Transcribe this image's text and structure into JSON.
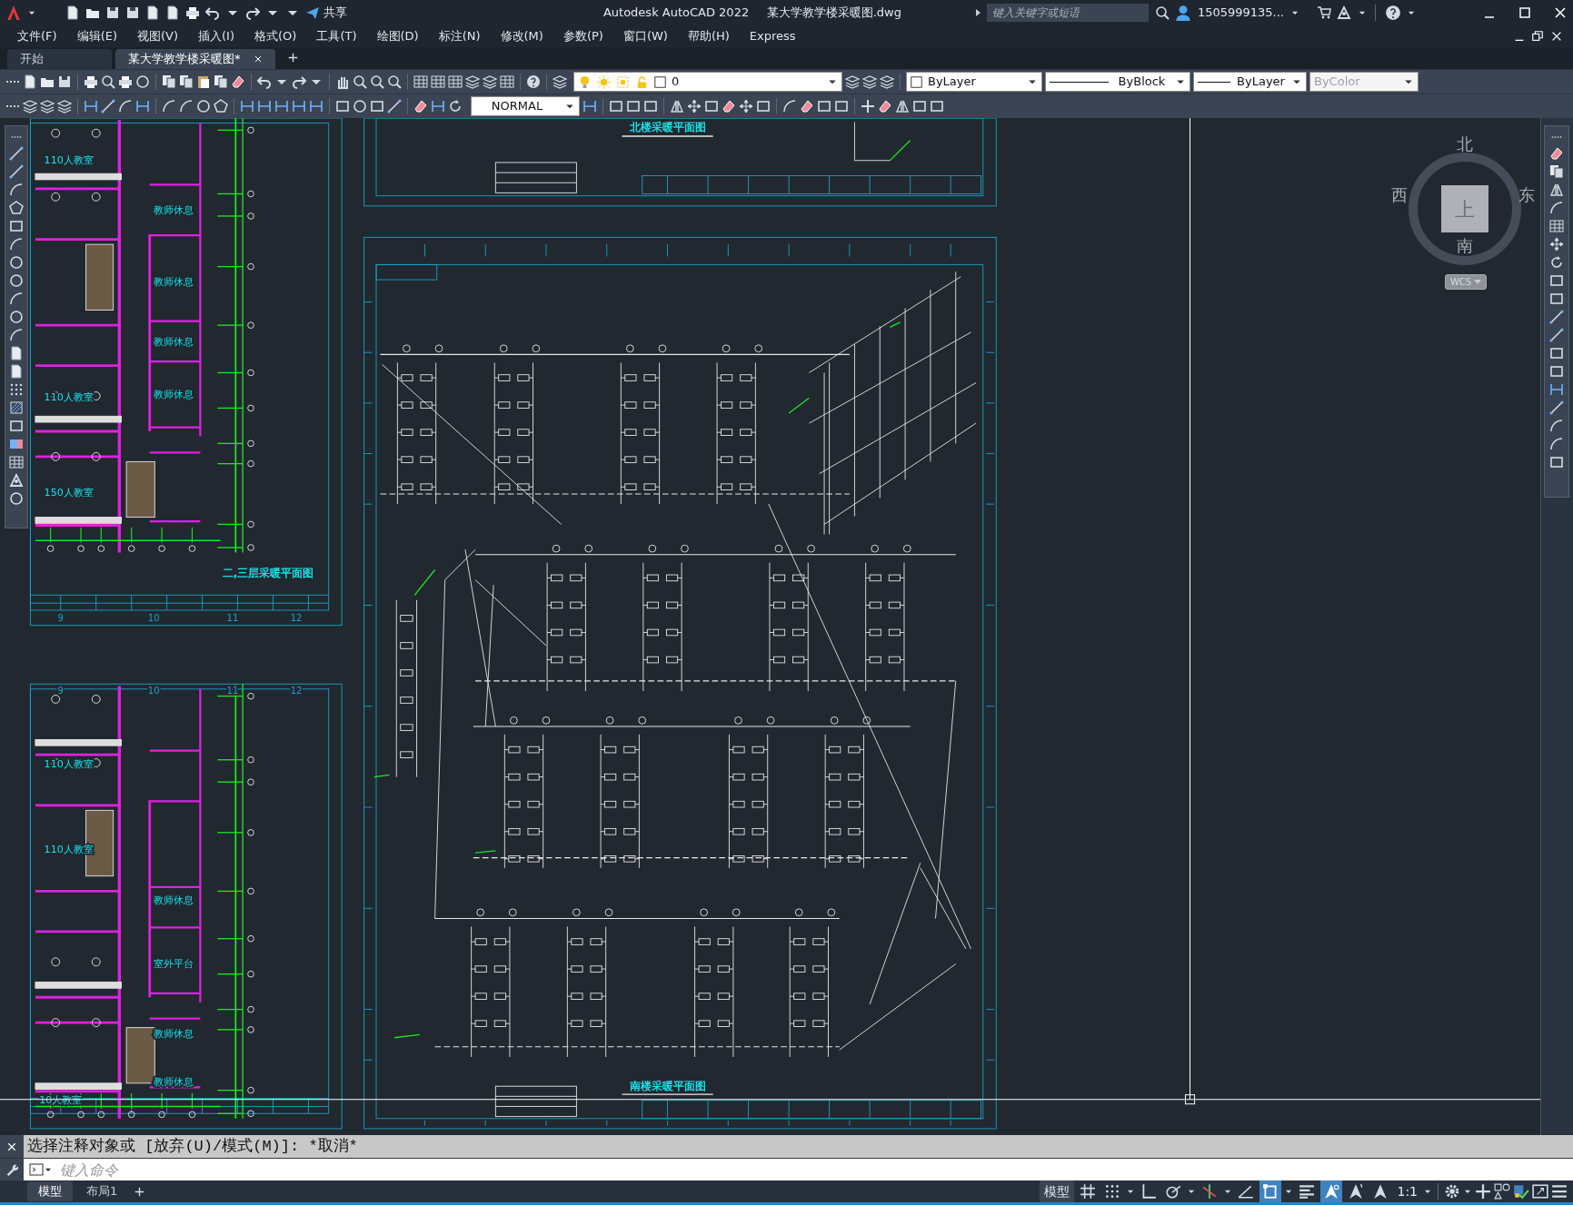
{
  "title_bar": {
    "share": "共享",
    "title": "Autodesk AutoCAD 2022",
    "file": "某大学教学楼采暖图.dwg",
    "search": {
      "placeholder": "键入关键字或短语"
    },
    "user": "1505999135..."
  },
  "menu": [
    "文件(F)",
    "编辑(E)",
    "视图(V)",
    "插入(I)",
    "格式(O)",
    "工具(T)",
    "绘图(D)",
    "标注(N)",
    "修改(M)",
    "参数(P)",
    "窗口(W)",
    "帮助(H)",
    "Express"
  ],
  "doc_tabs": [
    {
      "label": "开始",
      "selected": false
    },
    {
      "label": "某大学教学楼采暖图*",
      "selected": true
    }
  ],
  "properties": {
    "layer": "0",
    "color_dropdown": "ByLayer",
    "linetype": "ByBlock",
    "lineweight": "ByLayer",
    "plot_style": {
      "value": "ByColor",
      "disabled": true
    }
  },
  "dim_style": "NORMAL",
  "drawing": {
    "labels": [
      {
        "text": "110人教室",
        "kind": "room"
      },
      {
        "text": "教师休息",
        "kind": "room"
      },
      {
        "text": "教师休息",
        "kind": "room"
      },
      {
        "text": "教师休息",
        "kind": "room"
      },
      {
        "text": "教师休息",
        "kind": "room"
      },
      {
        "text": "110人教室",
        "kind": "room"
      },
      {
        "text": "150人教室",
        "kind": "room"
      },
      {
        "text": "二,三层采暖平面图",
        "kind": "title"
      },
      {
        "text": "9",
        "kind": "axis"
      },
      {
        "text": "10",
        "kind": "axis"
      },
      {
        "text": "11",
        "kind": "axis"
      },
      {
        "text": "12",
        "kind": "axis"
      },
      {
        "text": "9",
        "kind": "axis"
      },
      {
        "text": "10",
        "kind": "axis"
      },
      {
        "text": "11",
        "kind": "axis"
      },
      {
        "text": "12",
        "kind": "axis"
      },
      {
        "text": "110人教室",
        "kind": "room"
      },
      {
        "text": "110人教室",
        "kind": "room"
      },
      {
        "text": "教师休息",
        "kind": "room"
      },
      {
        "text": "室外平台",
        "kind": "room"
      },
      {
        "text": "教师休息",
        "kind": "room"
      },
      {
        "text": "教师休息",
        "kind": "room"
      },
      {
        "text": "10人教室",
        "kind": "room"
      },
      {
        "text": "北楼采暖平面图",
        "kind": "title"
      },
      {
        "text": "南楼采暖平面图",
        "kind": "title"
      }
    ]
  },
  "viewcube": {
    "north": "北",
    "west": "西",
    "east": "东",
    "south": "南",
    "face": "上",
    "coordinate_system": "WCS"
  },
  "command_line": {
    "history": "选择注释对象或 [放弃(U)/模式(M)]: *取消*",
    "input": {
      "placeholder": "键入命令"
    }
  },
  "layout_tabs": [
    {
      "label": "模型",
      "selected": true
    },
    {
      "label": "布局1",
      "selected": false
    }
  ],
  "status_bar": {
    "space": "模型",
    "toggles": [
      {
        "kind": "grid",
        "on": false
      },
      {
        "kind": "snap",
        "on": false
      },
      {
        "kind": "ortho",
        "on": false
      },
      {
        "kind": "polar",
        "on": false
      },
      {
        "kind": "iso",
        "on": false
      },
      {
        "kind": "angle",
        "on": false
      },
      {
        "kind": "osnap",
        "on": true
      },
      {
        "kind": "lineweight",
        "on": false
      },
      {
        "kind": "annovis",
        "on": true
      },
      {
        "kind": "autoscale",
        "on": false
      },
      {
        "kind": "annoscale",
        "on": false
      }
    ],
    "annotation_scale": "1:1"
  }
}
